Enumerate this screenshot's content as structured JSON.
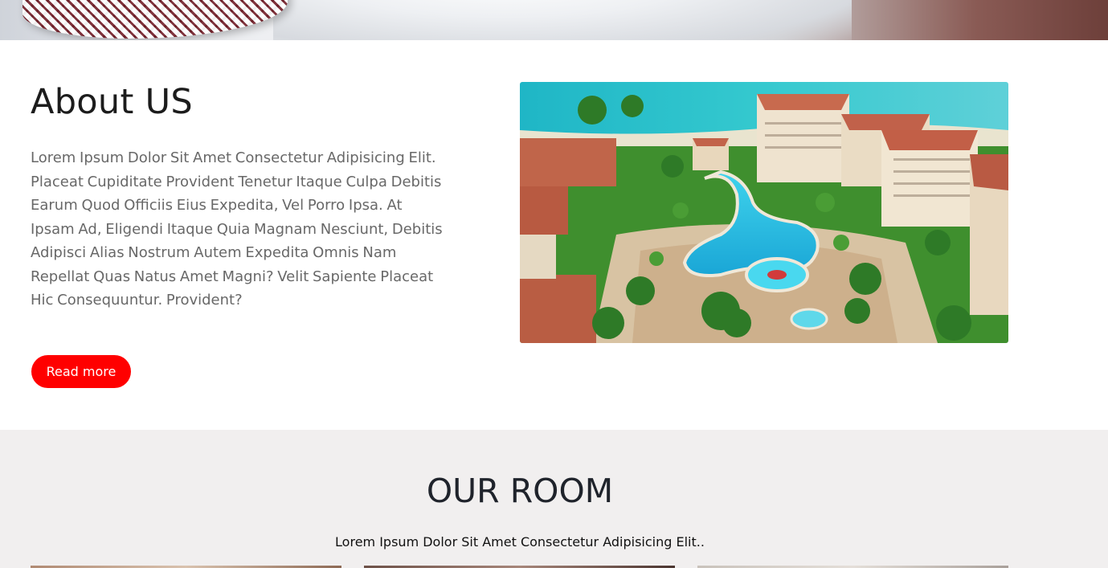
{
  "about": {
    "title": "About US",
    "text": "Lorem Ipsum Dolor Sit Amet Consectetur Adipisicing Elit. Placeat Cupiditate Provident Tenetur Itaque Culpa Debitis Earum Quod Officiis Eius Expedita, Vel Porro Ipsa. At Ipsam Ad, Eligendi Itaque Quia Magnam Nesciunt, Debitis Adipisci Alias Nostrum Autem Expedita Omnis Nam Repellat Quas Natus Amet Magni? Velit Sapiente Placeat Hic Consequuntur. Provident?",
    "button_label": "Read more",
    "button_color": "#ff0000"
  },
  "rooms": {
    "title": "OUR ROOM",
    "subtitle": "Lorem Ipsum Dolor Sit Amet Consectetur Adipisicing Elit.."
  },
  "colors": {
    "rooms_background": "#f1efef",
    "heading": "#1c1c1c",
    "body_text": "#686868"
  }
}
